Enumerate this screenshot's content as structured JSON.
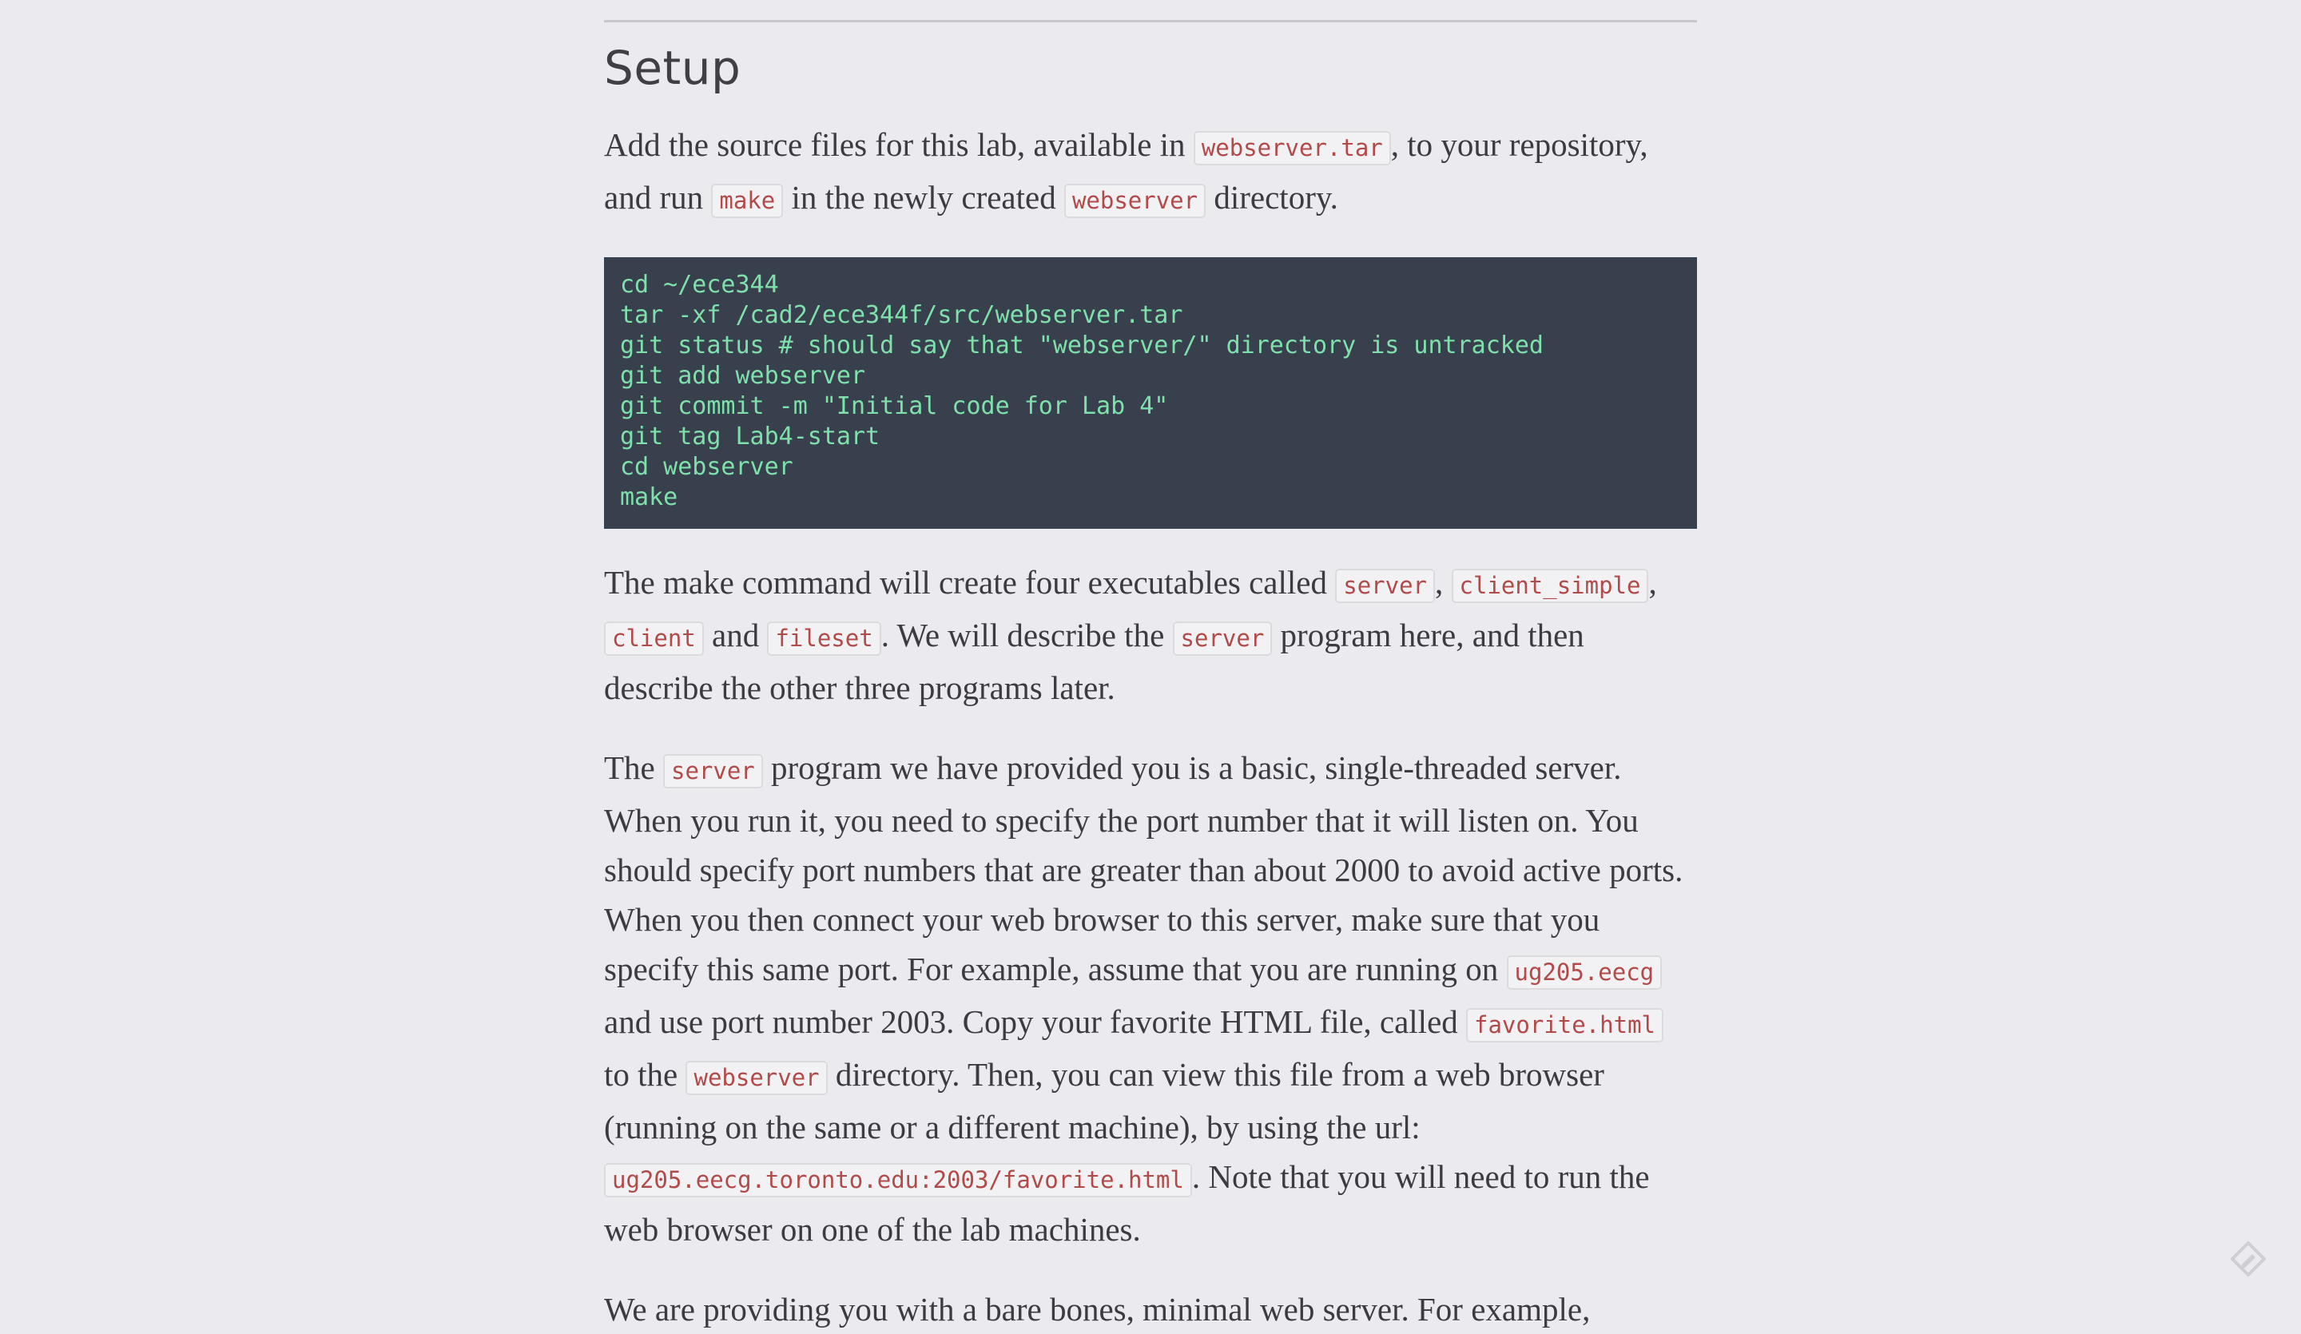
{
  "section": {
    "title": "Setup"
  },
  "intro": {
    "t1": "Add the source files for this lab, available in ",
    "c1": "webserver.tar",
    "t2": ", to your repository, and run ",
    "c2": "make",
    "t3": " in the newly created ",
    "c3": "webserver",
    "t4": " directory."
  },
  "commands": [
    "cd ~/ece344",
    "tar -xf /cad2/ece344f/src/webserver.tar",
    "git status # should say that \"webserver/\" directory is untracked",
    "git add webserver",
    "git commit -m \"Initial code for Lab 4\"",
    "git tag Lab4-start",
    "cd webserver",
    "make"
  ],
  "make_para": {
    "t1": "The make command will create four executables called ",
    "c1": "server",
    "t2": ", ",
    "c2": "client_simple",
    "t3": ", ",
    "c3": "client",
    "t4": " and ",
    "c4": "fileset",
    "t5": ". We will describe the ",
    "c5": "server",
    "t6": " program here, and then describe the other three programs later."
  },
  "server_para": {
    "t1": "The ",
    "c1": "server",
    "t2": " program we have provided you is a basic, single-threaded server. When you run it, you need to specify the port number that it will listen on. You should specify port numbers that are greater than about 2000 to avoid active ports. When you then connect your web browser to this server, make sure that you specify this same port. For example, assume that you are running on ",
    "c2": "ug205.eecg",
    "t3": " and use port number 2003. Copy your favorite HTML file, called ",
    "c3": "favorite.html",
    "t4": " to the ",
    "c4": "webserver",
    "t5": " directory. Then, you can view this file from a web browser (running on the same or a different machine), by using the url: ",
    "c5": "ug205.eecg.toronto.edu:2003/favorite.html",
    "t6": ". Note that you will need to run the web browser on one of the lab machines."
  },
  "last_para": {
    "text": "We are providing you with a bare bones, minimal web server. For example,"
  },
  "colors": {
    "background": "#ebeaee",
    "code_block_bg": "#37404c",
    "code_block_text": "#7fe0ac",
    "inline_code_text": "#b24a4a"
  },
  "icons": {
    "corner": "pencil-edit-icon"
  }
}
